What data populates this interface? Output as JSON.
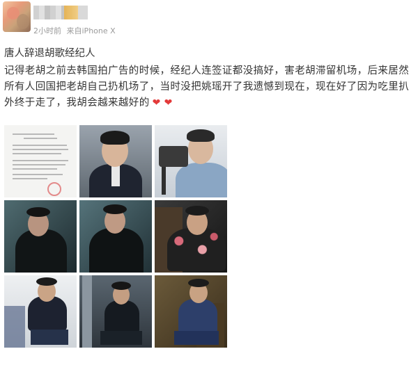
{
  "header": {
    "meta_time": "2小时前",
    "meta_source": "来自iPhone X"
  },
  "post": {
    "title": "唐人辞退胡歌经纪人",
    "body": "记得老胡之前去韩国拍广告的时候，经纪人连签证都没搞好，害老胡滞留机场，后来居然所有人回国把老胡自己扔机场了，当时没把姚瑶开了我遗憾到现在，现在好了因为吃里扒外终于走了，我胡会越来越好的",
    "emoji": "❤ ❤"
  },
  "photos": [
    {
      "name": "photo-document",
      "icon": "document-image"
    },
    {
      "name": "photo-portrait-suit",
      "icon": "portrait-image"
    },
    {
      "name": "photo-camera",
      "icon": "camera-image"
    },
    {
      "name": "photo-fur-coat-1",
      "icon": "portrait-image"
    },
    {
      "name": "photo-fur-coat-2",
      "icon": "portrait-image"
    },
    {
      "name": "photo-floral-shirt",
      "icon": "portrait-image"
    },
    {
      "name": "photo-stool-seated",
      "icon": "portrait-image"
    },
    {
      "name": "photo-chair-studio",
      "icon": "portrait-image"
    },
    {
      "name": "photo-denim-seated",
      "icon": "portrait-image"
    }
  ],
  "colors": {
    "text": "#333333",
    "meta": "#9a9a9a",
    "heart": "#e33a3a"
  }
}
